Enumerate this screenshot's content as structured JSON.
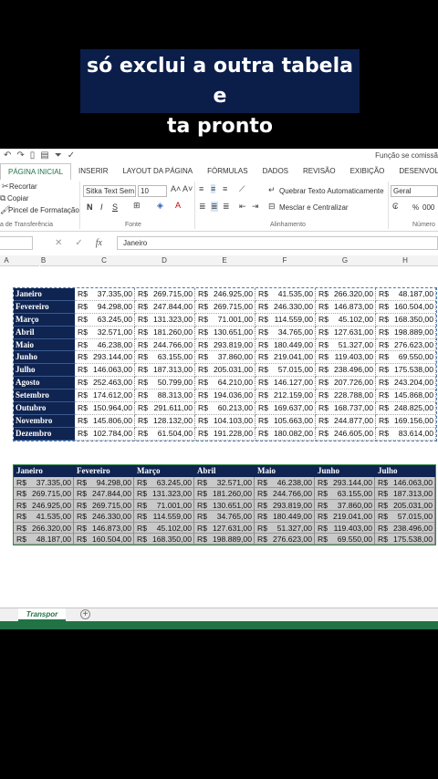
{
  "caption": {
    "line1": "só exclui a outra tabela e",
    "line2": "ta pronto"
  },
  "window": {
    "title": "Função se comissã"
  },
  "ribbon_tabs": [
    "PÁGINA INICIAL",
    "INSERIR",
    "LAYOUT DA PÁGINA",
    "FÓRMULAS",
    "DADOS",
    "REVISÃO",
    "EXIBIÇÃO",
    "DESENVOLVEDOR"
  ],
  "clipboard": {
    "cut": "Recortar",
    "copy": "Copiar",
    "painter": "Pincel de Formatação",
    "group": "a de Transferência"
  },
  "font": {
    "name": "Sitka Text Sem",
    "size": "10",
    "group": "Fonte",
    "bold": "N",
    "italic": "I",
    "underline": "S"
  },
  "alignment": {
    "wrap": "Quebrar Texto Automaticamente",
    "merge": "Mesclar e Centralizar",
    "group": "Alinhamento"
  },
  "number": {
    "format": "Geral",
    "group": "Número",
    "percent": "%",
    "thousands": "000"
  },
  "formula_bar": {
    "fx": "fx",
    "value": "Janeiro"
  },
  "columns": [
    "A",
    "B",
    "C",
    "D",
    "E",
    "F",
    "G",
    "H"
  ],
  "table1": {
    "rows": [
      {
        "label": "Janeiro",
        "values": [
          "37.335,00",
          "269.715,00",
          "246.925,00",
          "41.535,00",
          "266.320,00",
          "48.187,00"
        ]
      },
      {
        "label": "Fevereiro",
        "values": [
          "94.298,00",
          "247.844,00",
          "269.715,00",
          "246.330,00",
          "146.873,00",
          "160.504,00"
        ]
      },
      {
        "label": "Março",
        "values": [
          "63.245,00",
          "131.323,00",
          "71.001,00",
          "114.559,00",
          "45.102,00",
          "168.350,00"
        ]
      },
      {
        "label": "Abril",
        "values": [
          "32.571,00",
          "181.260,00",
          "130.651,00",
          "34.765,00",
          "127.631,00",
          "198.889,00"
        ]
      },
      {
        "label": "Maio",
        "values": [
          "46.238,00",
          "244.766,00",
          "293.819,00",
          "180.449,00",
          "51.327,00",
          "276.623,00"
        ]
      },
      {
        "label": "Junho",
        "values": [
          "293.144,00",
          "63.155,00",
          "37.860,00",
          "219.041,00",
          "119.403,00",
          "69.550,00"
        ]
      },
      {
        "label": "Julho",
        "values": [
          "146.063,00",
          "187.313,00",
          "205.031,00",
          "57.015,00",
          "238.496,00",
          "175.538,00"
        ]
      },
      {
        "label": "Agosto",
        "values": [
          "252.463,00",
          "50.799,00",
          "64.210,00",
          "146.127,00",
          "207.726,00",
          "243.204,00"
        ]
      },
      {
        "label": "Setembro",
        "values": [
          "174.612,00",
          "88.313,00",
          "194.036,00",
          "212.159,00",
          "228.788,00",
          "145.868,00"
        ]
      },
      {
        "label": "Outubro",
        "values": [
          "150.964,00",
          "291.611,00",
          "60.213,00",
          "169.637,00",
          "168.737,00",
          "248.825,00"
        ]
      },
      {
        "label": "Novembro",
        "values": [
          "145.806,00",
          "128.132,00",
          "104.103,00",
          "105.663,00",
          "244.877,00",
          "169.156,00"
        ]
      },
      {
        "label": "Dezembro",
        "values": [
          "102.784,00",
          "61.504,00",
          "191.228,00",
          "180.082,00",
          "246.605,00",
          "83.614,00"
        ]
      }
    ]
  },
  "table2": {
    "headers": [
      "Janeiro",
      "Fevereiro",
      "Março",
      "Abril",
      "Maio",
      "Junho",
      "Julho"
    ],
    "rows": [
      [
        "37.335,00",
        "94.298,00",
        "63.245,00",
        "32.571,00",
        "46.238,00",
        "293.144,00",
        "146.063,00"
      ],
      [
        "269.715,00",
        "247.844,00",
        "131.323,00",
        "181.260,00",
        "244.766,00",
        "63.155,00",
        "187.313,00"
      ],
      [
        "246.925,00",
        "269.715,00",
        "71.001,00",
        "130.651,00",
        "293.819,00",
        "37.860,00",
        "205.031,00"
      ],
      [
        "41.535,00",
        "246.330,00",
        "114.559,00",
        "34.765,00",
        "180.449,00",
        "219.041,00",
        "57.015,00"
      ],
      [
        "266.320,00",
        "146.873,00",
        "45.102,00",
        "127.631,00",
        "51.327,00",
        "119.403,00",
        "238.496,00"
      ],
      [
        "48.187,00",
        "160.504,00",
        "168.350,00",
        "198.889,00",
        "276.623,00",
        "69.550,00",
        "175.538,00"
      ]
    ]
  },
  "currency": "R$",
  "sheet": {
    "name": "Transpor",
    "add": "+"
  }
}
